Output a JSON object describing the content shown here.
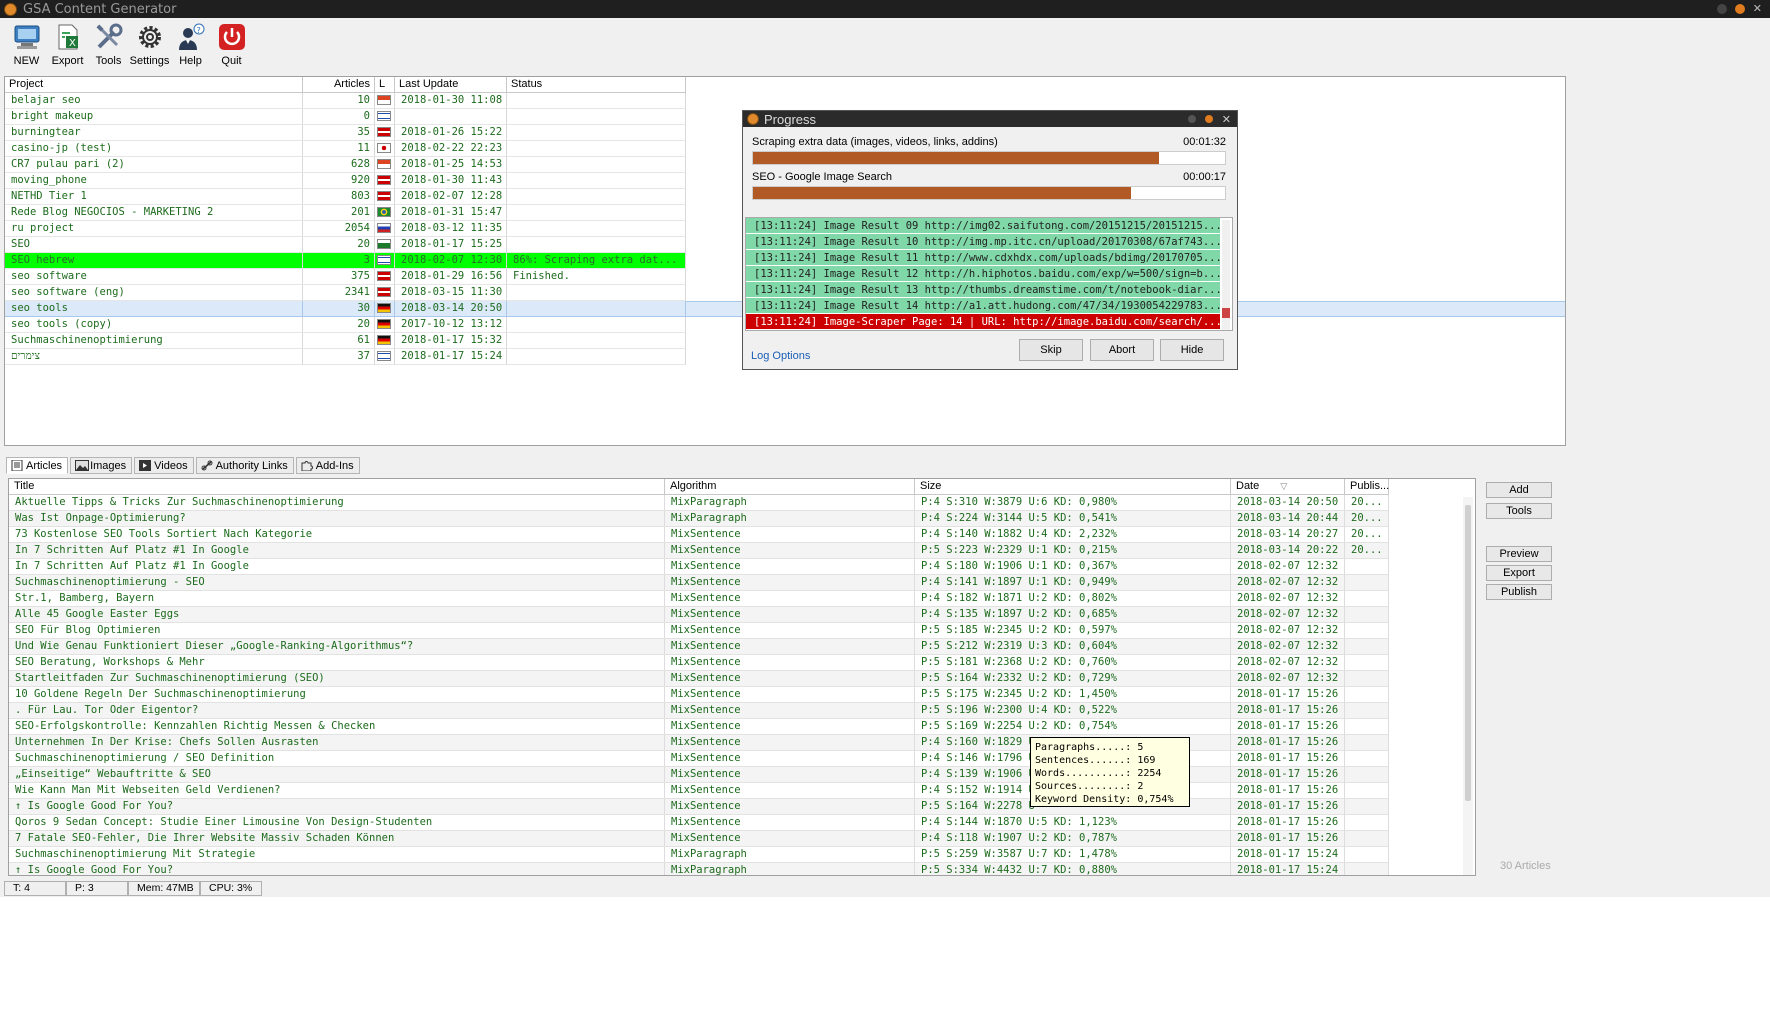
{
  "window": {
    "title": "GSA Content Generator"
  },
  "toolbar": [
    {
      "label": "NEW",
      "icon": "monitor-book-icon"
    },
    {
      "label": "Export",
      "icon": "excel-export-icon"
    },
    {
      "label": "Tools",
      "icon": "tools-icon"
    },
    {
      "label": "Settings",
      "icon": "gear-icon"
    },
    {
      "label": "Help",
      "icon": "help-user-icon"
    },
    {
      "label": "Quit",
      "icon": "power-icon"
    }
  ],
  "projects": {
    "headers": {
      "project": "Project",
      "articles": "Articles",
      "lang": "L",
      "last_update": "Last Update",
      "status": "Status"
    },
    "rows": [
      {
        "name": "belajar seo",
        "articles": "10",
        "flag": "id",
        "updated": "2018-01-30 11:08",
        "status": ""
      },
      {
        "name": "bright makeup",
        "articles": "0",
        "flag": "il",
        "updated": "",
        "status": ""
      },
      {
        "name": "burningtear",
        "articles": "35",
        "flag": "gb",
        "updated": "2018-01-26 15:22",
        "status": ""
      },
      {
        "name": "casino-jp (test)",
        "articles": "11",
        "flag": "jp",
        "updated": "2018-02-22 22:23",
        "status": ""
      },
      {
        "name": "CR7 pulau pari (2)",
        "articles": "628",
        "flag": "id",
        "updated": "2018-01-25 14:53",
        "status": ""
      },
      {
        "name": "moving_phone",
        "articles": "920",
        "flag": "gb",
        "updated": "2018-01-30 11:43",
        "status": ""
      },
      {
        "name": "NETHD Tier 1",
        "articles": "803",
        "flag": "gb",
        "updated": "2018-02-07 12:28",
        "status": ""
      },
      {
        "name": "Rede Blog NEGOCIOS - MARKETING 2",
        "articles": "201",
        "flag": "br",
        "updated": "2018-01-31 15:47",
        "status": ""
      },
      {
        "name": "ru project",
        "articles": "2054",
        "flag": "ru",
        "updated": "2018-03-12 11:35",
        "status": ""
      },
      {
        "name": "SEO",
        "articles": "20",
        "flag": "sa",
        "updated": "2018-01-17 15:25",
        "status": ""
      },
      {
        "name": "SEO hebrew",
        "articles": "3",
        "flag": "il",
        "updated": "2018-02-07 12:30",
        "status": "86%: Scraping extra dat..."
      },
      {
        "name": "seo software",
        "articles": "375",
        "flag": "gb",
        "updated": "2018-01-29 16:56",
        "status": "Finished."
      },
      {
        "name": "seo software (eng)",
        "articles": "2341",
        "flag": "gb",
        "updated": "2018-03-15 11:30",
        "status": ""
      },
      {
        "name": "seo tools",
        "articles": "30",
        "flag": "de",
        "updated": "2018-03-14 20:50",
        "status": ""
      },
      {
        "name": "seo tools (copy)",
        "articles": "20",
        "flag": "de",
        "updated": "2017-10-12 13:12",
        "status": ""
      },
      {
        "name": "Suchmaschinenoptimierung",
        "articles": "61",
        "flag": "de",
        "updated": "2018-01-17 15:32",
        "status": ""
      },
      {
        "name": "צימרים",
        "articles": "37",
        "flag": "il",
        "updated": "2018-01-17 15:24",
        "status": ""
      }
    ]
  },
  "progress": {
    "title": "Progress",
    "task1": {
      "label": "Scraping extra data (images, videos, links, addins)",
      "time": "00:01:32",
      "fraction": 0.86
    },
    "task2": {
      "label": "SEO - Google Image Search",
      "time": "00:00:17",
      "fraction": 0.8
    },
    "log": [
      "[13:11:24] Image Result 09 http://img02.saifutong.com/20151215/20151215...",
      "[13:11:24] Image Result 10 http://img.mp.itc.cn/upload/20170308/67af743...",
      "[13:11:24] Image Result 11 http://www.cdxhdx.com/uploads/bdimg/20170705...",
      "[13:11:24] Image Result 12 http://h.hiphotos.baidu.com/exp/w=500/sign=b...",
      "[13:11:24] Image Result 13 http://thumbs.dreamstime.com/t/notebook-diar...",
      "[13:11:24] Image Result 14 http://a1.att.hudong.com/47/34/1930054229783...",
      "[13:11:24] Image-Scraper Page: 14 | URL: http://image.baidu.com/search/..."
    ],
    "log_options": "Log Options",
    "skip": "Skip",
    "abort": "Abort",
    "hide": "Hide"
  },
  "tabs": [
    {
      "label": "Articles",
      "icon": "articles-icon"
    },
    {
      "label": "Images",
      "icon": "images-icon"
    },
    {
      "label": "Videos",
      "icon": "videos-icon"
    },
    {
      "label": "Authority Links",
      "icon": "link-icon"
    },
    {
      "label": "Add-Ins",
      "icon": "puzzle-icon"
    }
  ],
  "articles": {
    "headers": {
      "title": "Title",
      "algorithm": "Algorithm",
      "size": "Size",
      "date": "Date",
      "published": "Publis..."
    },
    "rows": [
      {
        "title": "Aktuelle Tipps & Tricks Zur Suchmaschinenoptimierung",
        "alg": "MixParagraph",
        "size": "P:4 S:310 W:3879 U:6 KD: 0,980%",
        "date": "2018-03-14 20:50",
        "pub": "20..."
      },
      {
        "title": "Was Ist Onpage-Optimierung?",
        "alg": "MixParagraph",
        "size": "P:4 S:224 W:3144 U:5 KD: 0,541%",
        "date": "2018-03-14 20:44",
        "pub": "20..."
      },
      {
        "title": "73 Kostenlose SEO Tools Sortiert Nach Kategorie",
        "alg": "MixSentence",
        "size": "P:4 S:140 W:1882 U:4 KD: 2,232%",
        "date": "2018-03-14 20:27",
        "pub": "20..."
      },
      {
        "title": "In 7 Schritten Auf Platz #1 In Google",
        "alg": "MixSentence",
        "size": "P:5 S:223 W:2329 U:1 KD: 0,215%",
        "date": "2018-03-14 20:22",
        "pub": "20..."
      },
      {
        "title": "In 7 Schritten Auf Platz #1 In Google",
        "alg": "MixSentence",
        "size": "P:4 S:180 W:1906 U:1 KD: 0,367%",
        "date": "2018-02-07 12:32",
        "pub": ""
      },
      {
        "title": "Suchmaschinenoptimierung - SEO",
        "alg": "MixSentence",
        "size": "P:4 S:141 W:1897 U:1 KD: 0,949%",
        "date": "2018-02-07 12:32",
        "pub": ""
      },
      {
        "title": "Str.1, Bamberg, Bayern",
        "alg": "MixSentence",
        "size": "P:4 S:182 W:1871 U:2 KD: 0,802%",
        "date": "2018-02-07 12:32",
        "pub": ""
      },
      {
        "title": "Alle 45 Google Easter Eggs",
        "alg": "MixSentence",
        "size": "P:4 S:135 W:1897 U:2 KD: 0,685%",
        "date": "2018-02-07 12:32",
        "pub": ""
      },
      {
        "title": "SEO Für Blog Optimieren",
        "alg": "MixSentence",
        "size": "P:5 S:185 W:2345 U:2 KD: 0,597%",
        "date": "2018-02-07 12:32",
        "pub": ""
      },
      {
        "title": "Und Wie Genau Funktioniert Dieser „Google-Ranking-Algorithmus“?",
        "alg": "MixSentence",
        "size": "P:5 S:212 W:2319 U:3 KD: 0,604%",
        "date": "2018-02-07 12:32",
        "pub": ""
      },
      {
        "title": "SEO Beratung, Workshops & Mehr",
        "alg": "MixSentence",
        "size": "P:5 S:181 W:2368 U:2 KD: 0,760%",
        "date": "2018-02-07 12:32",
        "pub": ""
      },
      {
        "title": "Startleitfaden Zur Suchmaschinenoptimierung (SEO)",
        "alg": "MixSentence",
        "size": "P:5 S:164 W:2332 U:2 KD: 0,729%",
        "date": "2018-02-07 12:32",
        "pub": ""
      },
      {
        "title": "10 Goldene Regeln Der Suchmaschinenoptimierung",
        "alg": "MixSentence",
        "size": "P:5 S:175 W:2345 U:2 KD: 1,450%",
        "date": "2018-01-17 15:26",
        "pub": ""
      },
      {
        "title": ". Für Lau. Tor Oder Eigentor?",
        "alg": "MixSentence",
        "size": "P:5 S:196 W:2300 U:4 KD: 0,522%",
        "date": "2018-01-17 15:26",
        "pub": ""
      },
      {
        "title": "SEO-Erfolgskontrolle: Kennzahlen Richtig Messen & Checken",
        "alg": "MixSentence",
        "size": "P:5 S:169 W:2254 U:2 KD: 0,754%",
        "date": "2018-01-17 15:26",
        "pub": ""
      },
      {
        "title": "Unternehmen In Der Krise: Chefs Sollen Ausrasten",
        "alg": "MixSentence",
        "size": "P:4 S:160 W:1829 U:",
        "date": "2018-01-17 15:26",
        "pub": ""
      },
      {
        "title": "Suchmaschinenoptimierung / SEO Definition",
        "alg": "MixSentence",
        "size": "P:4 S:146 W:1796 U",
        "date": "2018-01-17 15:26",
        "pub": ""
      },
      {
        "title": "„Einseitige“ Webauftritte & SEO",
        "alg": "MixSentence",
        "size": "P:4 S:139 W:1906 U",
        "date": "2018-01-17 15:26",
        "pub": ""
      },
      {
        "title": "Wie Kann Man Mit Webseiten Geld Verdienen?",
        "alg": "MixSentence",
        "size": "P:4 S:152 W:1914 U",
        "date": "2018-01-17 15:26",
        "pub": ""
      },
      {
        "title": "↑ Is Google Good For You?",
        "alg": "MixSentence",
        "size": "P:5 S:164 W:2278 U",
        "date": "2018-01-17 15:26",
        "pub": ""
      },
      {
        "title": "Qoros 9 Sedan Concept: Studie Einer Limousine Von Design-Studenten",
        "alg": "MixSentence",
        "size": "P:4 S:144 W:1870 U:5 KD: 1,123%",
        "date": "2018-01-17 15:26",
        "pub": ""
      },
      {
        "title": "7 Fatale SEO-Fehler, Die Ihrer Website Massiv Schaden Können",
        "alg": "MixSentence",
        "size": "P:4 S:118 W:1907 U:2 KD: 0,787%",
        "date": "2018-01-17 15:26",
        "pub": ""
      },
      {
        "title": "Suchmaschinenoptimierung Mit Strategie",
        "alg": "MixParagraph",
        "size": "P:5 S:259 W:3587 U:7 KD: 1,478%",
        "date": "2018-01-17 15:24",
        "pub": ""
      },
      {
        "title": "↑ Is Google Good For You?",
        "alg": "MixParagraph",
        "size": "P:5 S:334 W:4432 U:7 KD: 0,880%",
        "date": "2018-01-17 15:24",
        "pub": ""
      }
    ],
    "count": "30 Articles"
  },
  "tooltip": [
    "Paragraphs.....: 5",
    "Sentences......: 169",
    "Words..........: 2254",
    "Sources........: 2",
    "Keyword Density: 0,754%"
  ],
  "side_buttons": {
    "add": "Add",
    "tools": "Tools",
    "preview": "Preview",
    "export": "Export",
    "publish": "Publish"
  },
  "statusbar": {
    "threads": "T: 4",
    "projects": "P: 3",
    "mem": "Mem: 47MB",
    "cpu": "CPU: 3%"
  }
}
